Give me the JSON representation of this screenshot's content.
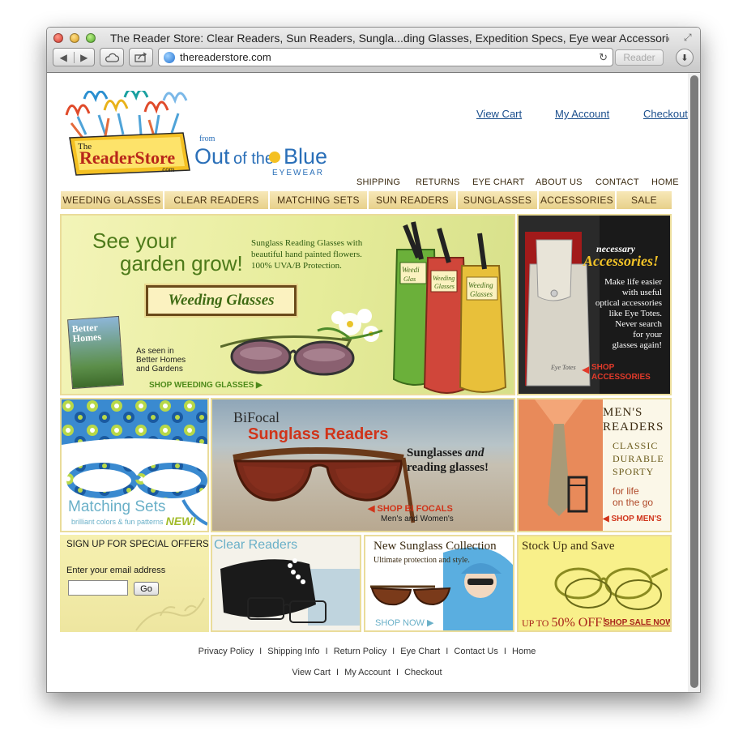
{
  "browser": {
    "window_title": "The Reader Store: Clear Readers, Sun Readers, Sungla...ding Glasses, Expedition Specs, Eye wear Accessories",
    "url": "thereaderstore.com",
    "reader_label": "Reader",
    "back_glyph": "◀",
    "forward_glyph": "▶",
    "reload_glyph": "↻",
    "icons": [
      "back-icon",
      "forward-icon",
      "icloud-icon",
      "share-icon",
      "globe-icon",
      "reload-icon",
      "download-icon",
      "fullscreen-icon"
    ]
  },
  "logo": {
    "brand_the": "The",
    "brand_name": "ReaderStore",
    "brand_com": ".com",
    "from": "from",
    "partner_a": "Out",
    "partner_b": "of the",
    "partner_c": "Blue",
    "partner_sub": "EYEWEAR"
  },
  "header_links": {
    "view_cart": "View Cart",
    "my_account": "My Account",
    "checkout": "Checkout"
  },
  "secondary_nav": {
    "shipping": "SHIPPING",
    "returns": "RETURNS",
    "eye_chart": "EYE CHART",
    "about_us": "ABOUT US",
    "contact": "CONTACT",
    "home": "HOME"
  },
  "menu": [
    {
      "label": "WEEDING GLASSES"
    },
    {
      "label": "CLEAR READERS"
    },
    {
      "label": "MATCHING SETS"
    },
    {
      "label": "SUN READERS"
    },
    {
      "label": "SUNGLASSES"
    },
    {
      "label": "ACCESSORIES"
    },
    {
      "label": "SALE"
    }
  ],
  "hero": {
    "headline_1": "See your",
    "headline_2": "garden grow!",
    "desc_1": "Sunglass Reading Glasses with",
    "desc_2": "beautiful hand painted flowers.",
    "desc_3": "100% UVA/B Protection.",
    "badge": "Weeding Glasses",
    "magazine_1": "Better",
    "magazine_2": "Homes",
    "seen_1": "As seen in",
    "seen_2": "Better Homes",
    "seen_3": "and Gardens",
    "cta": "SHOP WEEDING GLASSES ▶",
    "pouch_label_1": "Weedi",
    "pouch_label_2": "Glas",
    "pouch_label_3": "Weeding",
    "pouch_label_4": "Glasses",
    "pouch_label_5": "Weeding",
    "pouch_label_6": "Glasses"
  },
  "accessories": {
    "kicker": "necessary",
    "title": "Accessories!",
    "body_1": "Make life easier",
    "body_2": "with useful",
    "body_3": "optical accessories",
    "body_4": "like Eye Totes.",
    "body_5": "Never search",
    "body_6": "for your",
    "body_7": "glasses again!",
    "cta_1": "SHOP",
    "cta_2": "ACCESSORIES",
    "tote_script": "Eye Totes"
  },
  "matching": {
    "title": "Matching Sets",
    "sub": "brilliant colors & fun patterns",
    "badge": "NEW!"
  },
  "bifocal": {
    "line_1": "BiFocal",
    "line_2": "Sunglass Readers",
    "tag_1a": "Sunglasses ",
    "tag_1b": "and",
    "tag_2": "reading glasses!",
    "cta": "◀ SHOP BI FOCALS",
    "cta_sub": "Men's and Women's"
  },
  "mens": {
    "title_1": "MEN'S",
    "title_2": "READERS",
    "attr_1": "CLASSIC",
    "attr_2": "DURABLE",
    "attr_3": "SPORTY",
    "life_1": "for life",
    "life_2": "on the go",
    "cta": "◀ SHOP MEN'S"
  },
  "signup": {
    "title": "SIGN UP FOR SPECIAL OFFERS",
    "label": "Enter your email address",
    "placeholder": "",
    "button": "Go"
  },
  "clear_readers": {
    "title": "Clear Readers"
  },
  "new_collection": {
    "title": "New Sunglass Collection",
    "sub": "Ultimate protection and style.",
    "cta": "SHOP NOW ▶"
  },
  "sale": {
    "title": "Stock Up and Save",
    "prefix": "UP TO ",
    "amount": "50% OFF!",
    "cta": "SHOP SALE NOW"
  },
  "footer": {
    "row1": [
      "Privacy Policy",
      "Shipping Info",
      "Return Policy",
      "Eye Chart",
      "Contact Us",
      "Home"
    ],
    "row2": [
      "View Cart",
      "My Account",
      "Checkout"
    ],
    "sep": "I"
  }
}
